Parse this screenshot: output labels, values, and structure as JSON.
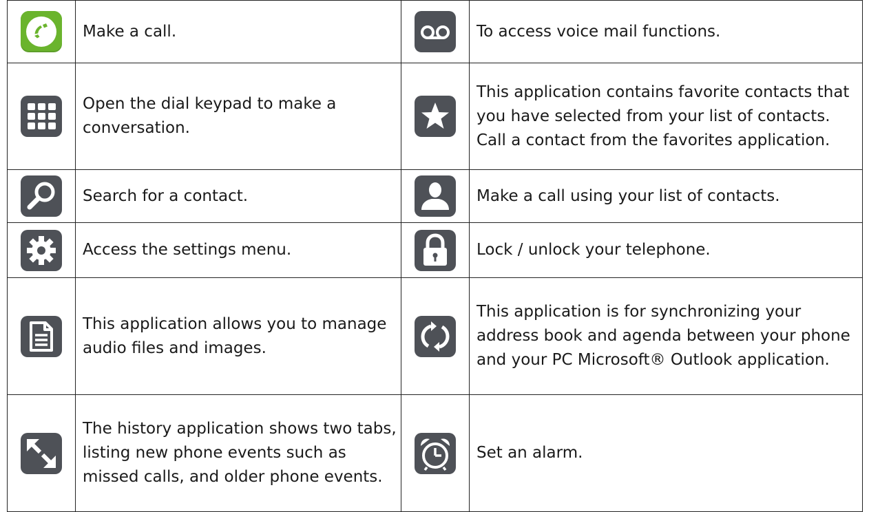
{
  "rows": [
    {
      "left": {
        "icon": "call-icon",
        "text": "Make a call."
      },
      "right": {
        "icon": "voicemail-icon",
        "text": "To access voice mail functions."
      }
    },
    {
      "left": {
        "icon": "keypad-icon",
        "text": "Open the dial keypad to make a conversation."
      },
      "right": {
        "icon": "star-icon",
        "text": "This application contains favorite contacts that you have selected from your list of contacts. Call a contact from the favorites application."
      }
    },
    {
      "left": {
        "icon": "search-icon",
        "text": "Search for a contact."
      },
      "right": {
        "icon": "contact-icon",
        "text": "Make a call using your list of contacts."
      }
    },
    {
      "left": {
        "icon": "gear-icon",
        "text": "Access the settings menu."
      },
      "right": {
        "icon": "lock-icon",
        "text": "Lock / unlock your telephone."
      }
    },
    {
      "left": {
        "icon": "document-icon",
        "text": "This application allows you to manage audio files and images."
      },
      "right": {
        "icon": "sync-icon",
        "text": "This application is for synchronizing your address book and agenda between your phone and your PC Microsoft® Outlook application."
      }
    },
    {
      "left": {
        "icon": "history-arrows-icon",
        "text": "The history application shows two tabs, listing new phone events such as missed calls, and older phone events."
      },
      "right": {
        "icon": "alarm-clock-icon",
        "text": "Set an alarm."
      }
    }
  ],
  "colors": {
    "icon_bg": "#4e5157",
    "call_bg": "#6ab42d",
    "icon_fg": "#ffffff",
    "border": "#222222"
  }
}
